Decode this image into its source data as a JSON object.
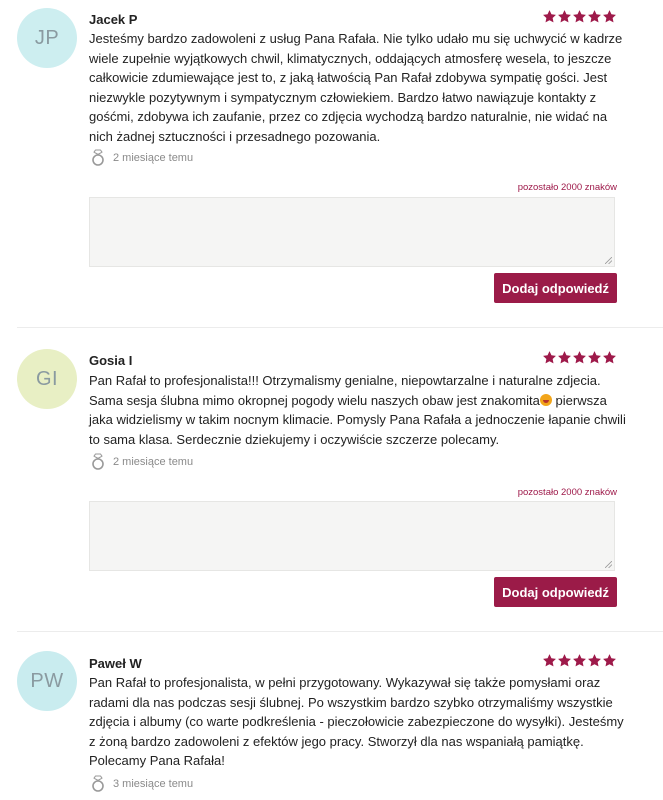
{
  "colors": {
    "accent": "#9b1b48",
    "star": "#9e1a4a",
    "avatar_jp": "#cdeef0",
    "avatar_gi": "#e8efc4",
    "avatar_pw": "#c9ecef"
  },
  "reviews": [
    {
      "initials": "JP",
      "author": "Jacek P",
      "rating": 5,
      "text": "Jesteśmy bardzo zadowoleni z usług Pana Rafała. Nie tylko udało mu się uchwycić w kadrze wiele zupełnie wyjątkowych chwil, klimatycznych, oddających atmosferę wesela, to jeszcze całkowicie zdumiewające jest to, z jaką łatwością Pan Rafał zdobywa sympatię gości. Jest niezwykle pozytywnym i sympatycznym człowiekiem. Bardzo łatwo nawiązuje kontakty z gośćmi, zdobywa ich zaufanie, przez co zdjęcia wychodzą bardzo naturalnie, nie widać na nich żadnej sztuczności i przesadnego pozowania.",
      "date": "2 miesiące temu",
      "counter": "pozostało 2000 znaków",
      "reply_placeholder": "",
      "reply_button": "Dodaj odpowiedź",
      "icon": "wedding-ring-icon"
    },
    {
      "initials": "GI",
      "author": "Gosia I",
      "rating": 5,
      "text_before_emoji": "Pan Rafał to profesjonalista!!! Otrzymalismy genialne, niepowtarzalne i naturalne zdjecia. Sama sesja ślubna mimo okropnej pogody wielu naszych obaw jest znakomita",
      "text_after_emoji": " pierwsza jaka widzielismy w takim nocnym klimacie. Pomysly Pana Rafała a jednoczenie łapanie chwili to sama klasa. Serdecznie dziekujemy i oczywiście szczerze polecamy.",
      "date": "2 miesiące temu",
      "counter": "pozostało 2000 znaków",
      "reply_placeholder": "",
      "reply_button": "Dodaj odpowiedź",
      "icon": "wedding-ring-icon"
    },
    {
      "initials": "PW",
      "author": "Paweł W",
      "rating": 5,
      "text": "Pan Rafał to profesjonalista, w pełni przygotowany. Wykazywał się także pomysłami oraz radami dla nas podczas sesji ślubnej. Po wszystkim bardzo szybko otrzymaliśmy wszystkie zdjęcia i albumy (co warte podkreślenia - pieczołowicie zabezpieczone do wysyłki). Jesteśmy z żoną bardzo zadowoleni z efektów jego pracy. Stworzył dla nas wspaniałą pamiątkę. Polecamy Pana Rafała!",
      "date": "3 miesiące temu",
      "icon": "wedding-ring-icon"
    }
  ]
}
